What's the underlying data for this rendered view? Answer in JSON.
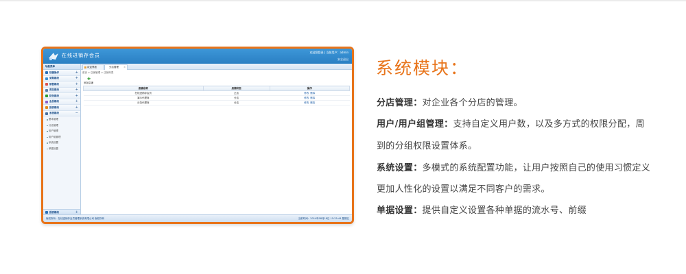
{
  "screenshot": {
    "app_title": "在线进销存会员",
    "user_welcome": "欢迎您登录 | 当前用户：admin",
    "exit_link": "安全退出",
    "sidebar": {
      "header": "功能菜单",
      "collapse": "«",
      "menus": [
        {
          "label": "快捷操作",
          "toggle": "+",
          "color": "#2a6fb5"
        },
        {
          "label": "采购模块",
          "toggle": "+",
          "color": "#3a8fd0"
        },
        {
          "label": "销售模块",
          "toggle": "+",
          "color": "#d9534f"
        },
        {
          "label": "库存模块",
          "toggle": "+",
          "color": "#5b7fa8"
        },
        {
          "label": "财务模块",
          "toggle": "+",
          "color": "#2e9b2e"
        },
        {
          "label": "会员模块",
          "toggle": "+",
          "color": "#8a5ec8"
        },
        {
          "label": "报表模块",
          "toggle": "+",
          "color": "#e08a1e"
        },
        {
          "label": "系统模块",
          "toggle": "−",
          "color": "#4a6f9a"
        }
      ],
      "sub_items": [
        "基本管理",
        "分店管理",
        "用户管理",
        "用户组管理",
        "系统设置",
        "单据设置"
      ],
      "bottom_menu": {
        "label": "报表模块",
        "toggle": "+"
      }
    },
    "tabs": [
      {
        "label": "欢迎界面"
      },
      {
        "label": "分店管理",
        "close": "×"
      }
    ],
    "breadcrumb": "首页 > 店铺管理 > 店铺列表",
    "add_icon": "✚",
    "add_label": "添加店铺",
    "table": {
      "headers": [
        "店铺名称",
        "店铺状态",
        "操作"
      ],
      "rows": [
        {
          "name": "在线进销存会员",
          "status": "正店",
          "ops": [
            "修改",
            "删除"
          ]
        },
        {
          "name": "演示代理商",
          "status": "分店",
          "ops": [
            "修改",
            "删除"
          ]
        },
        {
          "name": "示范代理商",
          "status": "分店",
          "ops": [
            "修改",
            "删除"
          ]
        }
      ]
    },
    "status_left": "版权所有：在线进销存会员管理系统有限公司 版权所有",
    "status_right": "当前时间：2014年08月18日 15:25:44 星期五"
  },
  "content": {
    "title": "系统模块：",
    "features": [
      {
        "name": "分店管理：",
        "desc": "对企业各个分店的管理。"
      },
      {
        "name": "用户/用户组管理：",
        "desc": "支持自定义用户数，以及多方式的权限分配，周"
      },
      {
        "name": "",
        "desc": "到的分组权限设置体系。"
      },
      {
        "name": "系统设置：",
        "desc": "多模式的系统配置功能，让用户按照自己的使用习惯定义"
      },
      {
        "name": "",
        "desc": "更加人性化的设置以满足不同客户的需求。"
      },
      {
        "name": "单据设置：",
        "desc": "提供自定义设置各种单据的流水号、前缀"
      }
    ]
  }
}
